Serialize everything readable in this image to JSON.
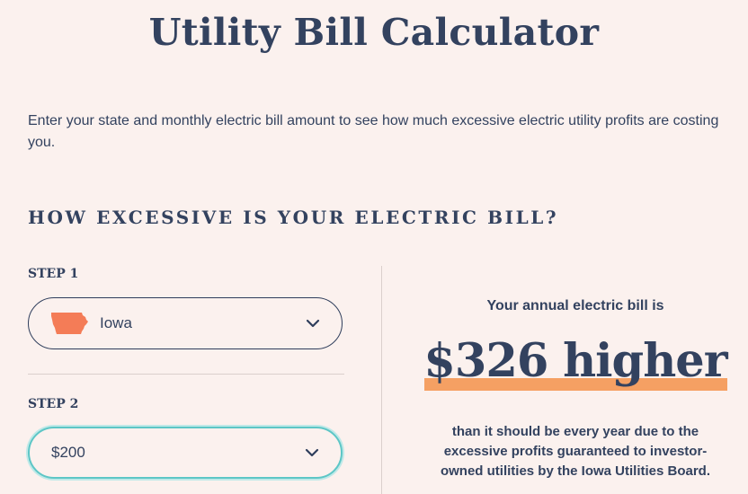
{
  "page": {
    "title": "Utility Bill Calculator",
    "intro": "Enter your state and monthly electric bill amount to see how much excessive electric utility profits are costing you."
  },
  "calculator": {
    "heading": "How excessive is your electric bill?",
    "step1": {
      "label": "STEP 1",
      "selected_state": "Iowa",
      "state_icon": "iowa-state-shape-icon"
    },
    "step2": {
      "label": "STEP 2",
      "selected_amount": "$200"
    },
    "colors": {
      "text": "#33425f",
      "background": "#fbf1ee",
      "state_shape": "#f47c57",
      "highlight": "#f5a063",
      "focus_ring": "#5dc6c6"
    }
  },
  "result": {
    "lead": "Your annual electric bill is",
    "amount": "$326 higher",
    "tail": "than it should be every year due to the excessive profits guaranteed to investor-owned utilities by the Iowa Utilities Board."
  }
}
